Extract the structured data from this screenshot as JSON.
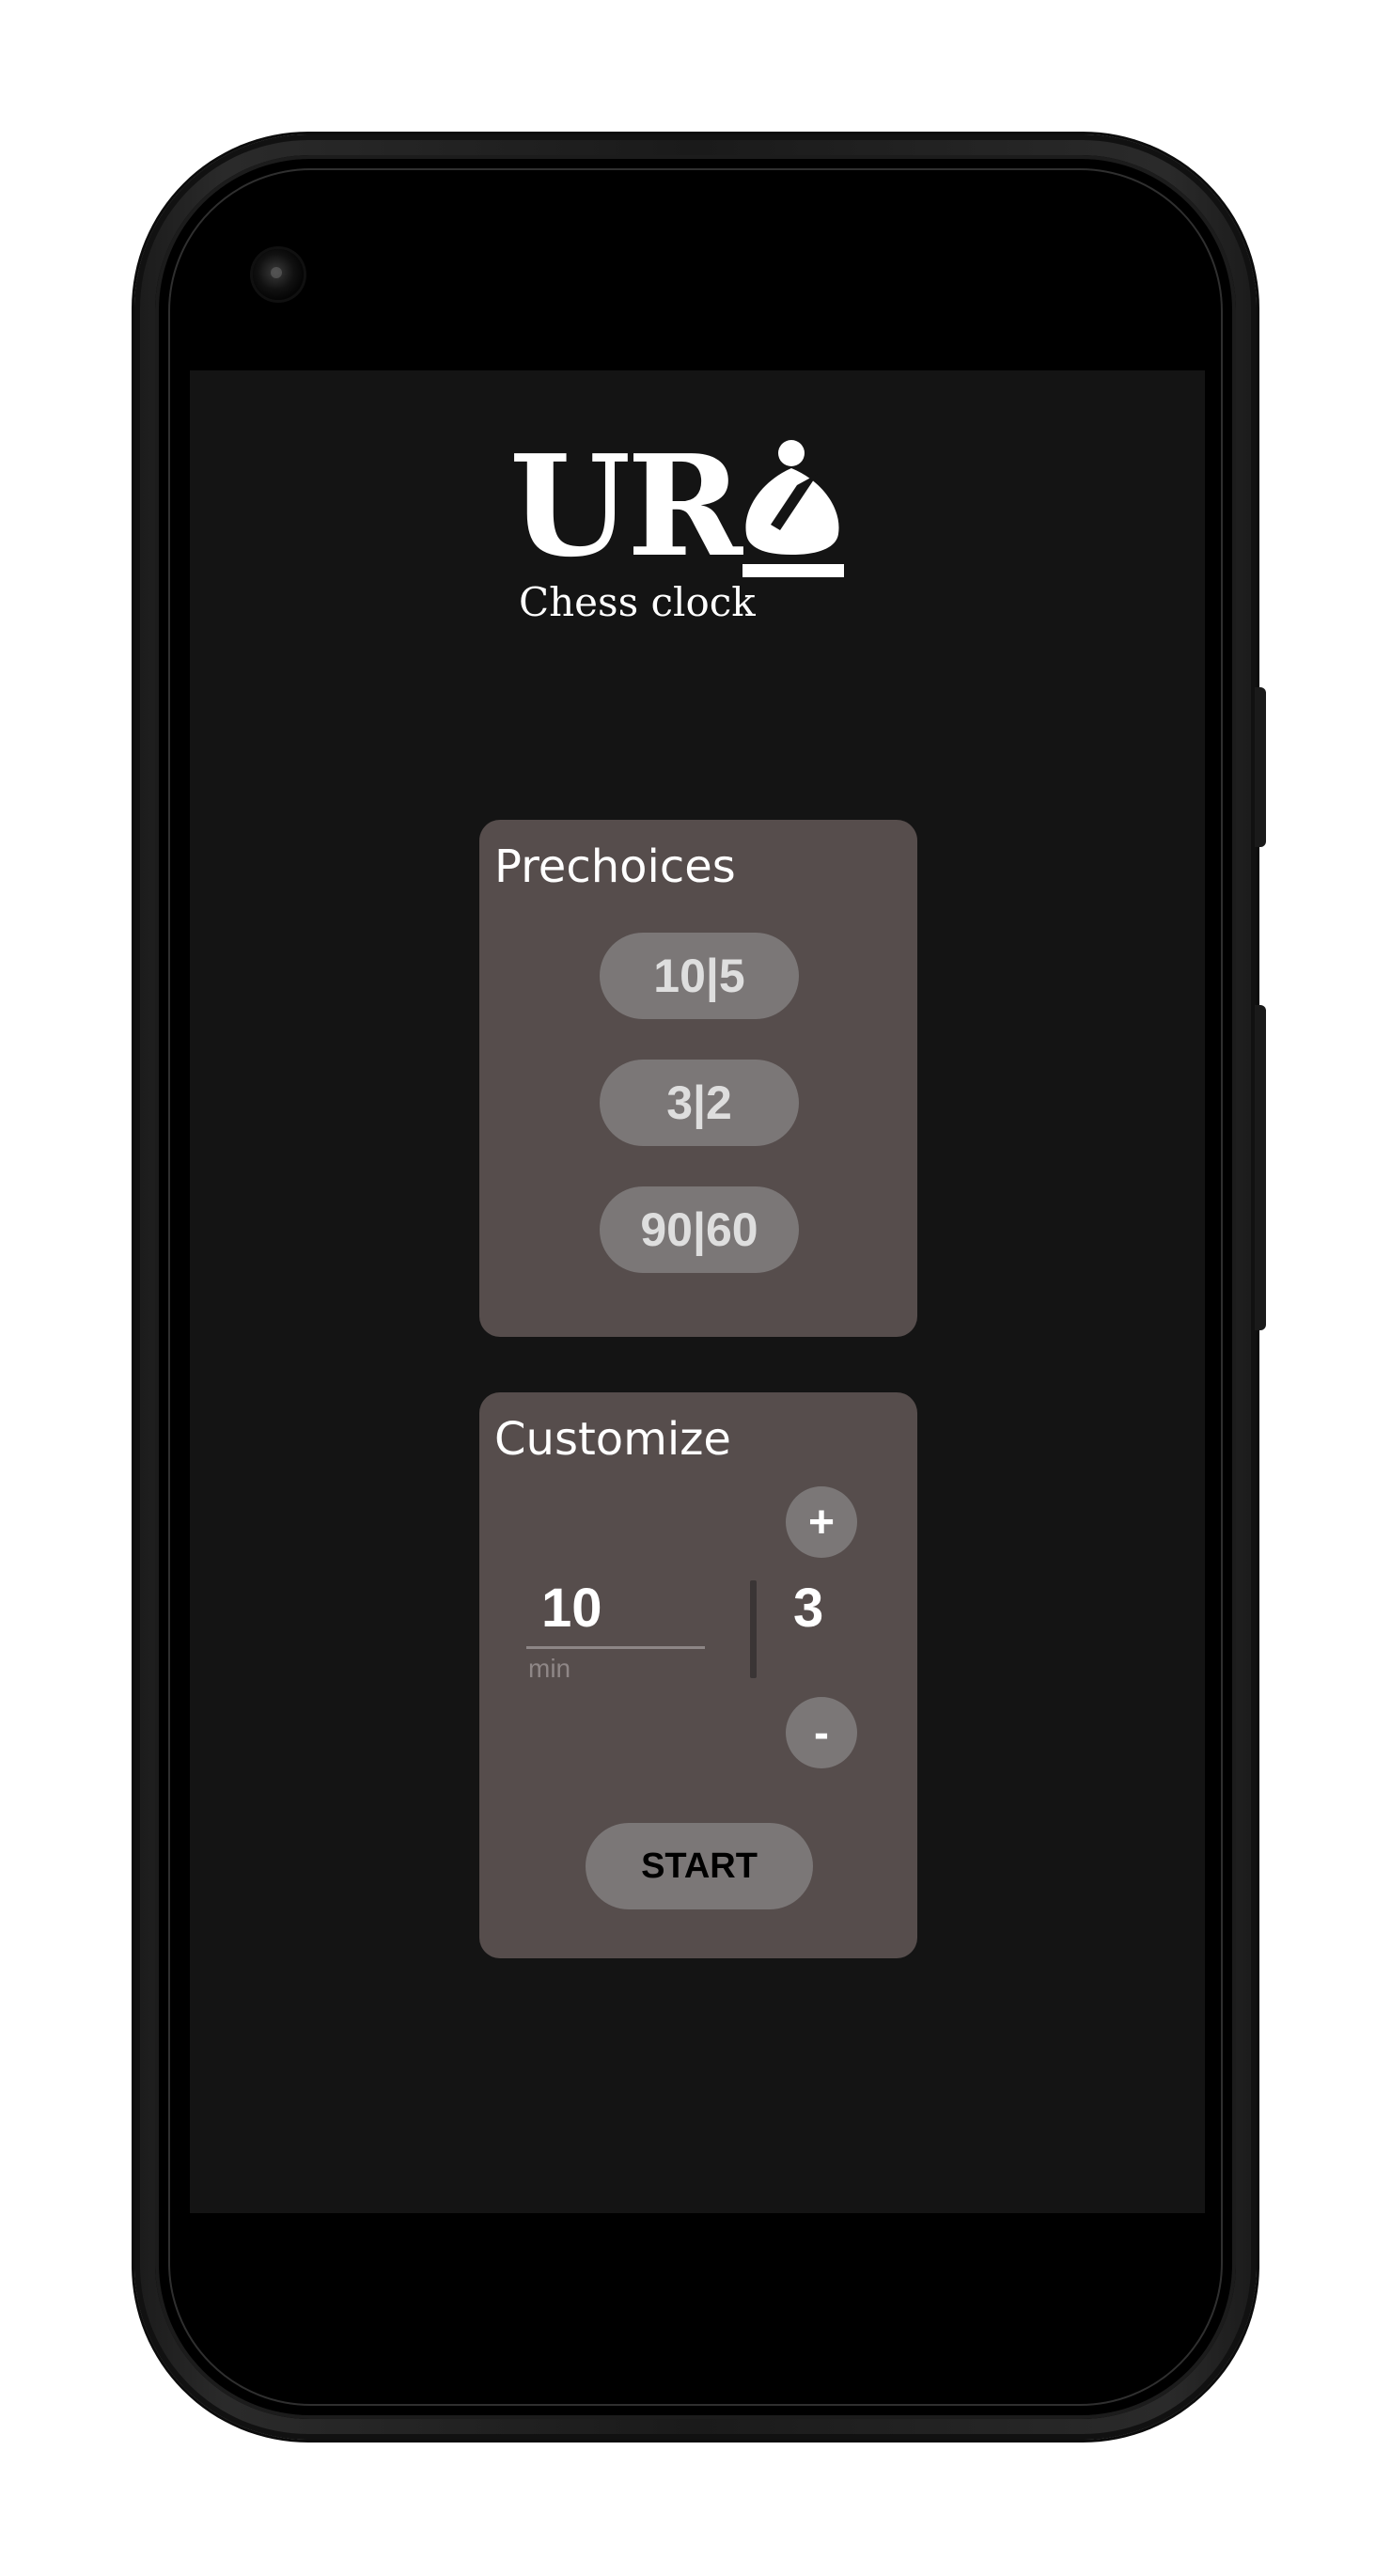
{
  "app": {
    "logo_text": "UR",
    "logo_icon": "chess-bishop-icon",
    "subtitle": "Chess clock"
  },
  "prechoices": {
    "title": "Prechoices",
    "options": [
      "10|5",
      "3|2",
      "90|60"
    ]
  },
  "customize": {
    "title": "Customize",
    "minutes_value": "10",
    "minutes_hint": "min",
    "increment_value": "3",
    "plus_label": "+",
    "minus_label": "-",
    "start_label": "START"
  },
  "colors": {
    "screen_bg": "#141414",
    "card_bg": "#564d4c",
    "button_bg": "#7b7777",
    "text": "#ffffff"
  }
}
